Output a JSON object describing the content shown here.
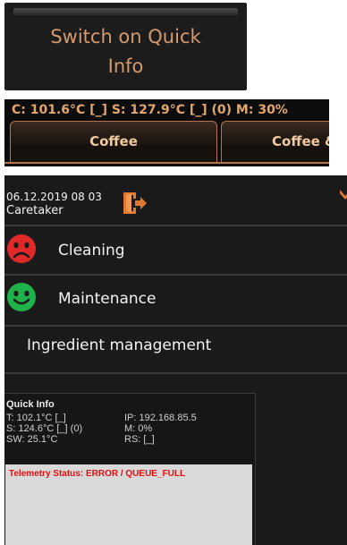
{
  "quick_info_button": {
    "label": "Switch on Quick Info"
  },
  "status_bar": {
    "text": "C: 101.6°C [_] S: 127.9°C [_] (0)   M: 30%"
  },
  "tabs": [
    {
      "label": "Coffee"
    },
    {
      "label": "Coffee &"
    }
  ],
  "header": {
    "datetime": "06.12.2019 08 03",
    "user": "Caretaker"
  },
  "menu": [
    {
      "label": "Cleaning",
      "status": "sad",
      "icon": "sad-face-icon",
      "color": "#e02a2a"
    },
    {
      "label": "Maintenance",
      "status": "happy",
      "icon": "happy-face-icon",
      "color": "#1fb14a"
    },
    {
      "label": "Ingredient management"
    }
  ],
  "quick_info": {
    "title": "Quick Info",
    "left": [
      "T: 102.1°C [_]",
      "S: 124.6°C [_] (0)",
      "SW: 25.1°C"
    ],
    "right": [
      "IP: 192.168.85.5",
      "M: 0%",
      "RS: [_]"
    ],
    "telemetry": "Telemetry Status: ERROR / QUEUE_FULL"
  },
  "colors": {
    "accent_text": "#d49a6e",
    "status_text": "#e2a66d",
    "tab_border": "#b8734a",
    "error_text": "#e01010"
  }
}
